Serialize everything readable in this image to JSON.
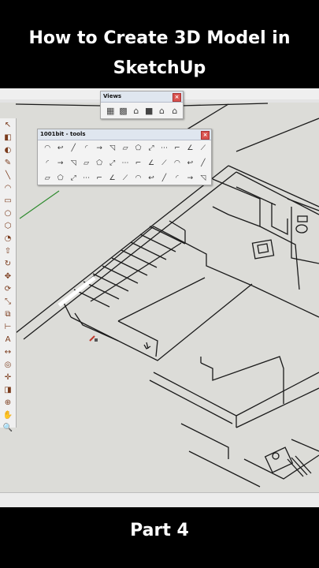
{
  "header": {
    "line1": "How to Create 3D Model in",
    "line2": "SketchUp"
  },
  "footer": {
    "label": "Part 4"
  },
  "views_palette": {
    "title": "Views",
    "icons": [
      "iso-view-icon",
      "top-view-icon",
      "front-view-icon",
      "right-view-icon",
      "back-view-icon",
      "left-view-icon"
    ]
  },
  "tools_palette": {
    "title": "1001bit - tools",
    "rows": [
      [
        "arc-tool-icon",
        "curve-tool-icon",
        "line-tool-icon",
        "fillet-tool-icon",
        "extend-tool-icon",
        "chamfer-tool-icon",
        "offset-tool-icon",
        "loft-tool-icon",
        "scale-tool-icon",
        "divide-tool-icon",
        "corner-tool-icon",
        "angle-tool-icon",
        "slope-tool-icon"
      ],
      [
        "stair-tool-icon",
        "spiral-stair-icon",
        "pitched-roof-icon",
        "wall-tool-icon",
        "opening-tool-icon",
        "window-tool-icon",
        "door-tool-icon",
        "beam-tool-icon",
        "column-tool-icon",
        "rafter-tool-icon",
        "purlin-tool-icon",
        "joist-tool-icon",
        "truss-tool-icon"
      ],
      [
        "grid-tool-icon",
        "plane-tool-icon",
        "panel-tool-icon",
        "array-tool-icon",
        "mesh-tool-icon",
        "frame-tool-icon",
        "louvre-tool-icon",
        "stairs-alt-icon",
        "rail-tool-icon",
        "align-tool-icon",
        "rotate-tool-icon",
        "copy-tool-icon",
        "cloud-tool-icon"
      ]
    ]
  },
  "left_toolbar": {
    "icons": [
      "select-icon",
      "eraser-icon",
      "paint-bucket-icon",
      "pencil-icon",
      "line-icon",
      "arc-icon",
      "rectangle-icon",
      "circle-icon",
      "polygon-icon",
      "pie-icon",
      "push-pull-icon",
      "follow-me-icon",
      "move-icon",
      "rotate-icon",
      "scale-icon",
      "offset-icon",
      "tape-measure-icon",
      "text-icon",
      "dimension-icon",
      "protractor-icon",
      "axes-icon",
      "section-plane-icon",
      "orbit-icon",
      "pan-icon",
      "zoom-icon",
      "zoom-extents-icon",
      "walk-icon",
      "look-around-icon"
    ]
  },
  "colors": {
    "background": "#000000",
    "canvas": "#dcdcd8",
    "line": "#1a1a1a",
    "axis_green": "#2e8b2e",
    "title_text": "#ffffff"
  }
}
